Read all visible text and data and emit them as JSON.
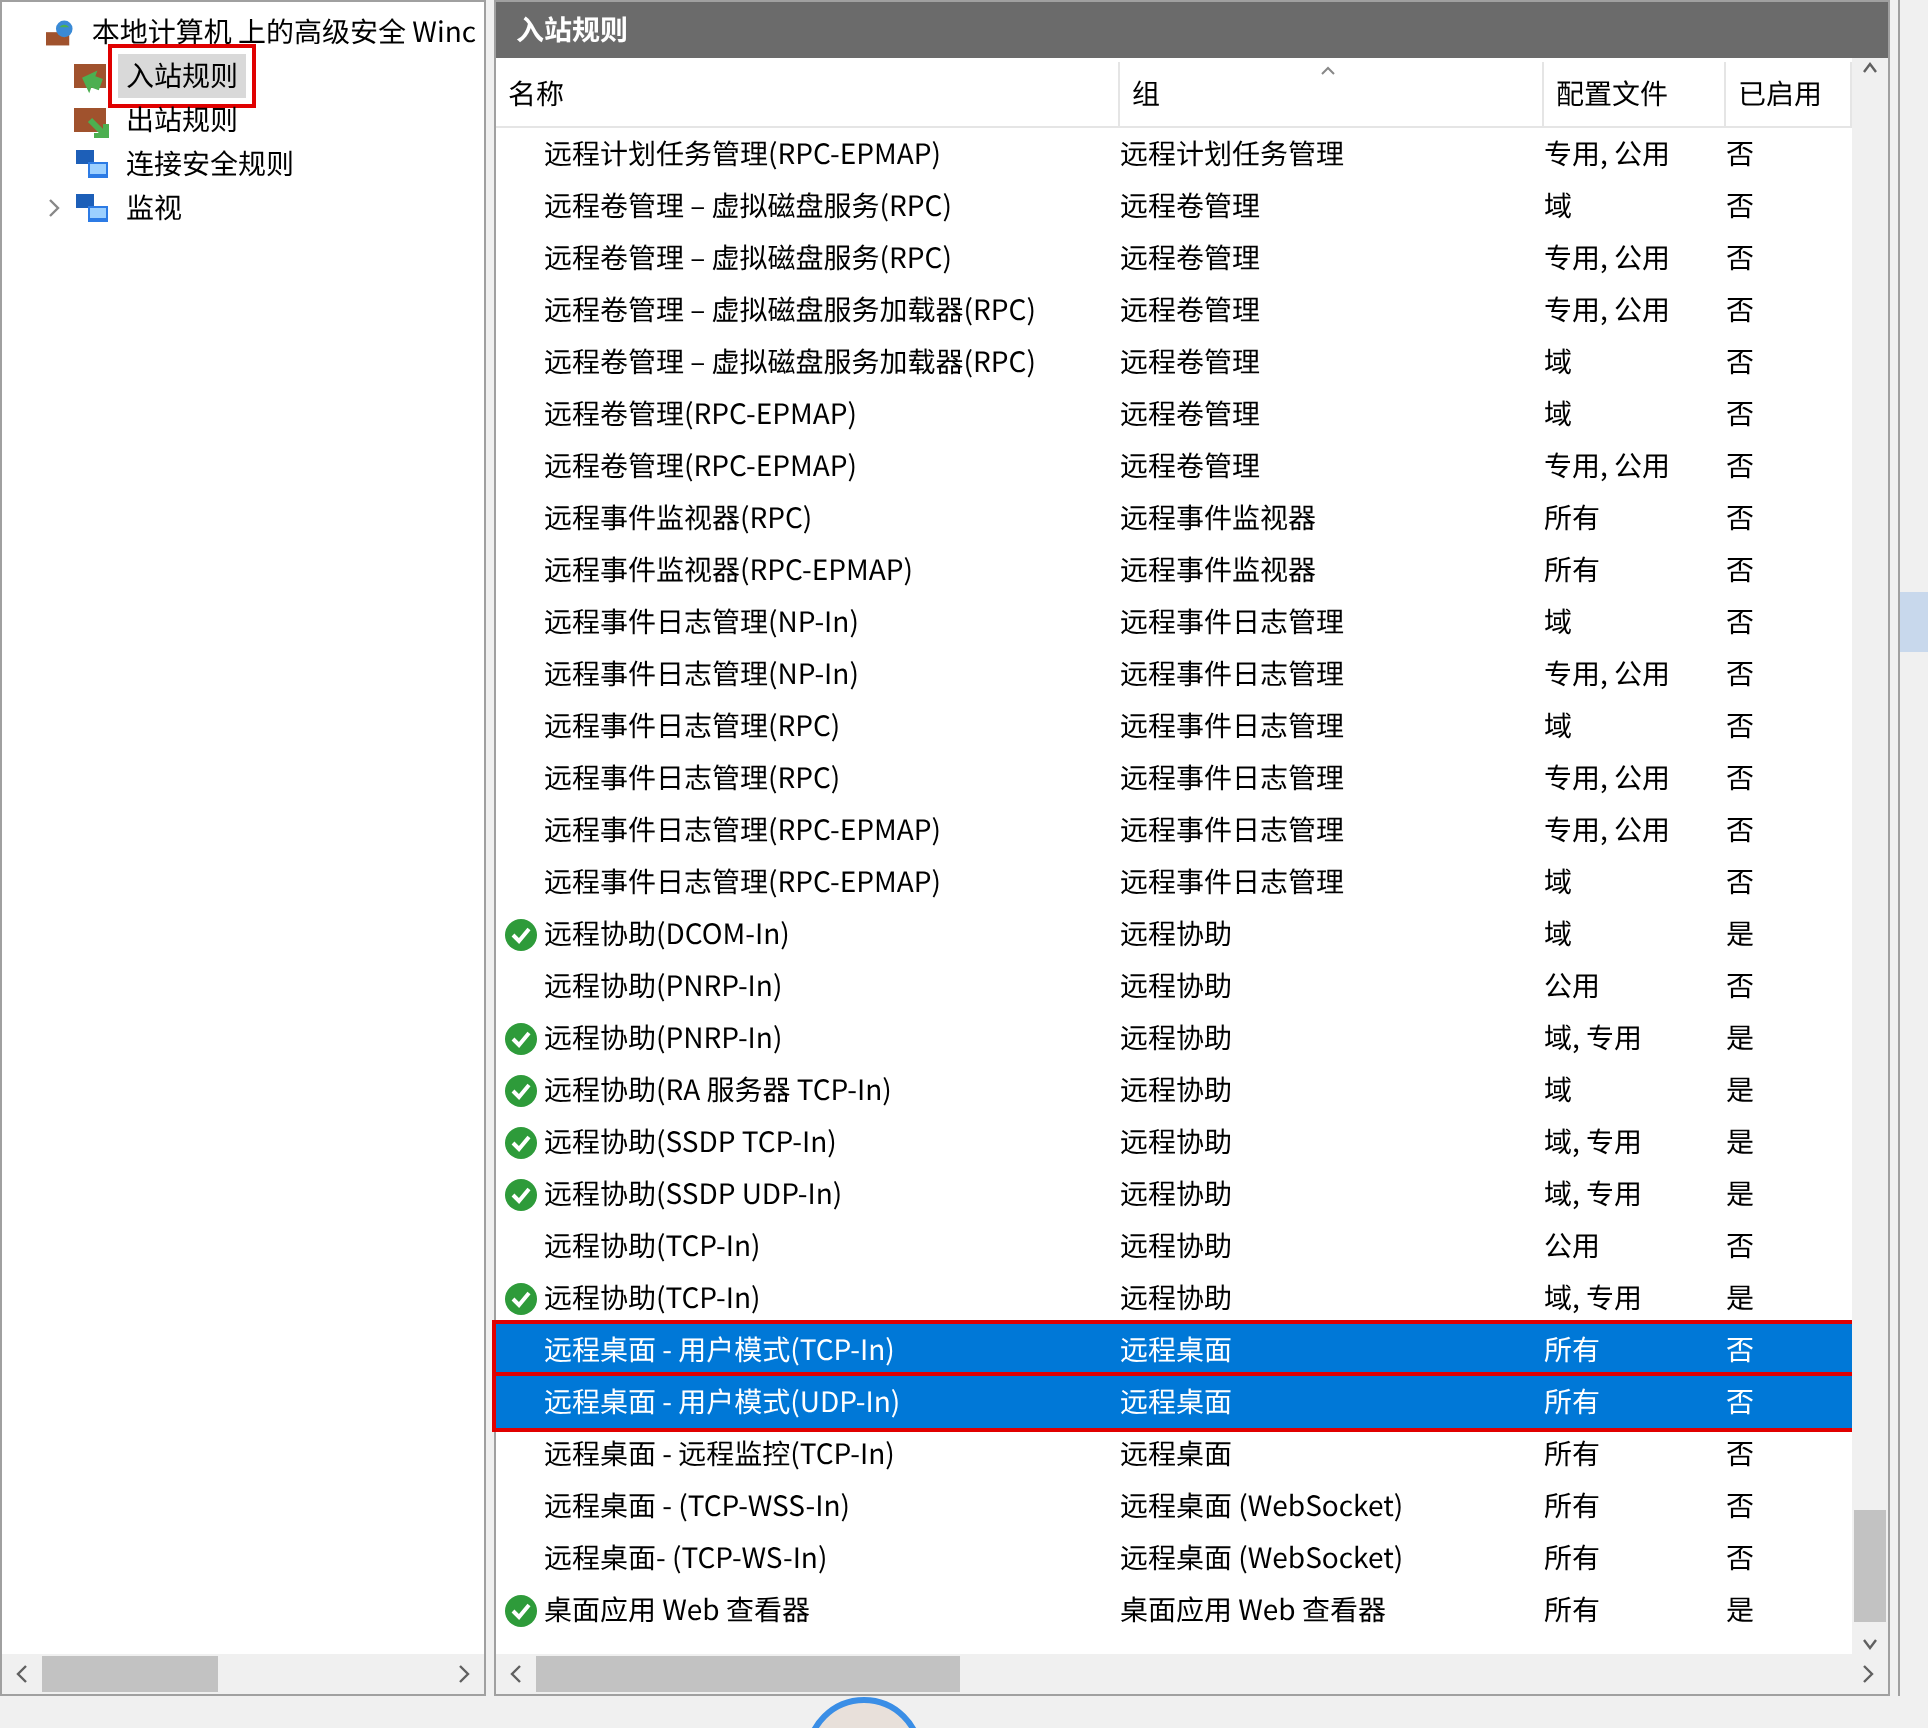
{
  "sidebar": {
    "tree": [
      {
        "label": "本地计算机 上的高级安全 Winc",
        "kind": "globe",
        "children": [
          {
            "label": "入站规则",
            "kind": "inbound",
            "selected": true,
            "highlighted": true
          },
          {
            "label": "出站规则",
            "kind": "outbound",
            "selected": false,
            "highlighted": false
          },
          {
            "label": "连接安全规则",
            "kind": "monitor",
            "selected": false,
            "highlighted": false
          },
          {
            "label": "监视",
            "kind": "monitor",
            "selected": false,
            "highlighted": false,
            "expanded": false
          }
        ]
      }
    ]
  },
  "panel": {
    "title": "入站规则"
  },
  "table": {
    "columns": [
      "名称",
      "组",
      "配置文件",
      "已启用"
    ],
    "rows": [
      {
        "name": "远程计划任务管理(RPC-EPMAP)",
        "group": "远程计划任务管理",
        "profile": "专用, 公用",
        "enabled": "否",
        "active": false,
        "selected": false,
        "highlighted": false
      },
      {
        "name": "远程卷管理 – 虚拟磁盘服务(RPC)",
        "group": "远程卷管理",
        "profile": "域",
        "enabled": "否",
        "active": false,
        "selected": false,
        "highlighted": false
      },
      {
        "name": "远程卷管理 – 虚拟磁盘服务(RPC)",
        "group": "远程卷管理",
        "profile": "专用, 公用",
        "enabled": "否",
        "active": false,
        "selected": false,
        "highlighted": false
      },
      {
        "name": "远程卷管理 – 虚拟磁盘服务加载器(RPC)",
        "group": "远程卷管理",
        "profile": "专用, 公用",
        "enabled": "否",
        "active": false,
        "selected": false,
        "highlighted": false
      },
      {
        "name": "远程卷管理 – 虚拟磁盘服务加载器(RPC)",
        "group": "远程卷管理",
        "profile": "域",
        "enabled": "否",
        "active": false,
        "selected": false,
        "highlighted": false
      },
      {
        "name": "远程卷管理(RPC-EPMAP)",
        "group": "远程卷管理",
        "profile": "域",
        "enabled": "否",
        "active": false,
        "selected": false,
        "highlighted": false
      },
      {
        "name": "远程卷管理(RPC-EPMAP)",
        "group": "远程卷管理",
        "profile": "专用, 公用",
        "enabled": "否",
        "active": false,
        "selected": false,
        "highlighted": false
      },
      {
        "name": "远程事件监视器(RPC)",
        "group": "远程事件监视器",
        "profile": "所有",
        "enabled": "否",
        "active": false,
        "selected": false,
        "highlighted": false
      },
      {
        "name": "远程事件监视器(RPC-EPMAP)",
        "group": "远程事件监视器",
        "profile": "所有",
        "enabled": "否",
        "active": false,
        "selected": false,
        "highlighted": false
      },
      {
        "name": "远程事件日志管理(NP-In)",
        "group": "远程事件日志管理",
        "profile": "域",
        "enabled": "否",
        "active": false,
        "selected": false,
        "highlighted": false
      },
      {
        "name": "远程事件日志管理(NP-In)",
        "group": "远程事件日志管理",
        "profile": "专用, 公用",
        "enabled": "否",
        "active": false,
        "selected": false,
        "highlighted": false
      },
      {
        "name": "远程事件日志管理(RPC)",
        "group": "远程事件日志管理",
        "profile": "域",
        "enabled": "否",
        "active": false,
        "selected": false,
        "highlighted": false
      },
      {
        "name": "远程事件日志管理(RPC)",
        "group": "远程事件日志管理",
        "profile": "专用, 公用",
        "enabled": "否",
        "active": false,
        "selected": false,
        "highlighted": false
      },
      {
        "name": "远程事件日志管理(RPC-EPMAP)",
        "group": "远程事件日志管理",
        "profile": "专用, 公用",
        "enabled": "否",
        "active": false,
        "selected": false,
        "highlighted": false
      },
      {
        "name": "远程事件日志管理(RPC-EPMAP)",
        "group": "远程事件日志管理",
        "profile": "域",
        "enabled": "否",
        "active": false,
        "selected": false,
        "highlighted": false
      },
      {
        "name": "远程协助(DCOM-In)",
        "group": "远程协助",
        "profile": "域",
        "enabled": "是",
        "active": true,
        "selected": false,
        "highlighted": false
      },
      {
        "name": "远程协助(PNRP-In)",
        "group": "远程协助",
        "profile": "公用",
        "enabled": "否",
        "active": false,
        "selected": false,
        "highlighted": false
      },
      {
        "name": "远程协助(PNRP-In)",
        "group": "远程协助",
        "profile": "域, 专用",
        "enabled": "是",
        "active": true,
        "selected": false,
        "highlighted": false
      },
      {
        "name": "远程协助(RA 服务器 TCP-In)",
        "group": "远程协助",
        "profile": "域",
        "enabled": "是",
        "active": true,
        "selected": false,
        "highlighted": false
      },
      {
        "name": "远程协助(SSDP TCP-In)",
        "group": "远程协助",
        "profile": "域, 专用",
        "enabled": "是",
        "active": true,
        "selected": false,
        "highlighted": false
      },
      {
        "name": "远程协助(SSDP UDP-In)",
        "group": "远程协助",
        "profile": "域, 专用",
        "enabled": "是",
        "active": true,
        "selected": false,
        "highlighted": false
      },
      {
        "name": "远程协助(TCP-In)",
        "group": "远程协助",
        "profile": "公用",
        "enabled": "否",
        "active": false,
        "selected": false,
        "highlighted": false
      },
      {
        "name": "远程协助(TCP-In)",
        "group": "远程协助",
        "profile": "域, 专用",
        "enabled": "是",
        "active": true,
        "selected": false,
        "highlighted": false
      },
      {
        "name": "远程桌面 - 用户模式(TCP-In)",
        "group": "远程桌面",
        "profile": "所有",
        "enabled": "否",
        "active": false,
        "selected": true,
        "highlighted": true
      },
      {
        "name": "远程桌面 - 用户模式(UDP-In)",
        "group": "远程桌面",
        "profile": "所有",
        "enabled": "否",
        "active": false,
        "selected": true,
        "highlighted": true
      },
      {
        "name": "远程桌面 - 远程监控(TCP-In)",
        "group": "远程桌面",
        "profile": "所有",
        "enabled": "否",
        "active": false,
        "selected": false,
        "highlighted": false
      },
      {
        "name": "远程桌面 - (TCP-WSS-In)",
        "group": "远程桌面 (WebSocket)",
        "profile": "所有",
        "enabled": "否",
        "active": false,
        "selected": false,
        "highlighted": false
      },
      {
        "name": "远程桌面- (TCP-WS-In)",
        "group": "远程桌面 (WebSocket)",
        "profile": "所有",
        "enabled": "否",
        "active": false,
        "selected": false,
        "highlighted": false
      },
      {
        "name": "桌面应用 Web 查看器",
        "group": "桌面应用 Web 查看器",
        "profile": "所有",
        "enabled": "是",
        "active": true,
        "selected": false,
        "highlighted": false
      }
    ]
  }
}
